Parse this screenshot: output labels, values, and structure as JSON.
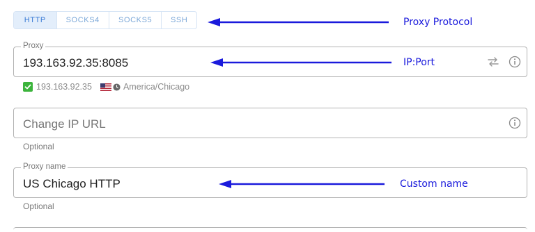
{
  "protocol_tabs": [
    {
      "label": "HTTP",
      "active": true
    },
    {
      "label": "SOCKS4",
      "active": false
    },
    {
      "label": "SOCKS5",
      "active": false
    },
    {
      "label": "SSH",
      "active": false
    }
  ],
  "proxy_field": {
    "label": "Proxy",
    "value": "193.163.92.35:8085",
    "swap_icon": "swap-arrows-icon",
    "info_icon": "info-icon"
  },
  "proxy_status": {
    "check_icon": "check-icon",
    "ip": "193.163.92.35",
    "flag_icon": "us-flag-icon",
    "clock_icon": "clock-icon",
    "timezone": "America/Chicago"
  },
  "change_ip_field": {
    "placeholder": "Change IP URL",
    "helper": "Optional",
    "info_icon": "info-icon"
  },
  "proxy_name_field": {
    "label": "Proxy name",
    "value": "US Chicago HTTP",
    "helper": "Optional"
  },
  "annotations": {
    "protocol": "Proxy Protocol",
    "ip_port": "IP:Port",
    "custom_name": "Custom name"
  },
  "colors": {
    "accent": "#3a7bd5",
    "tab_active_bg": "#e3eefb",
    "check_green": "#3cb43c",
    "annotation_blue": "#1a1adc",
    "border": "#b3b3b3"
  }
}
